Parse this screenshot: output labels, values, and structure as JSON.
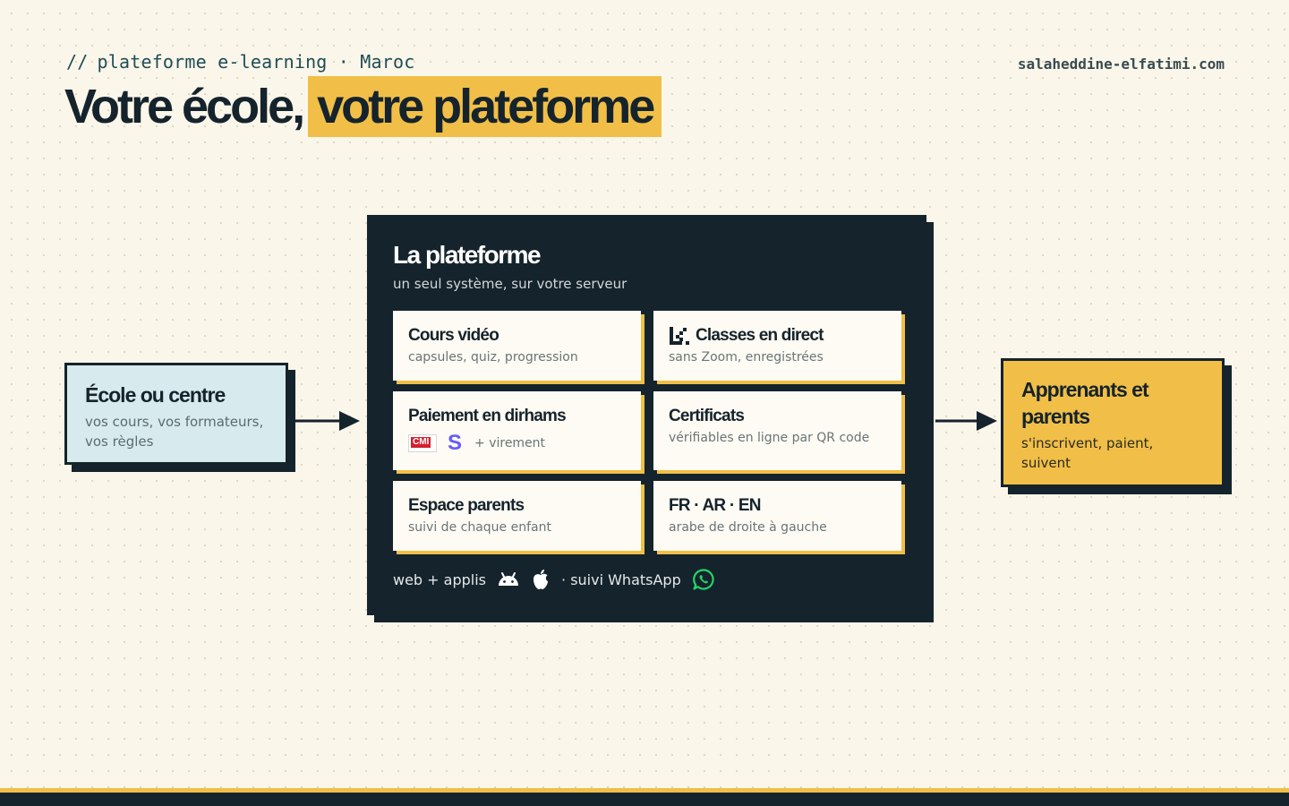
{
  "header": {
    "kicker_prefix": "//",
    "kicker": "plateforme e-learning · Maroc",
    "site": "salaheddine-elfatimi.com",
    "title_part1": "Votre école,",
    "title_highlight": "votre plateforme"
  },
  "left_box": {
    "title": "École ou centre",
    "subtitle": "vos cours, vos formateurs, vos règles"
  },
  "right_box": {
    "title": "Apprenants et parents",
    "subtitle": "s'inscrivent, paient, suivent"
  },
  "platform": {
    "title": "La plateforme",
    "subtitle": "un seul système, sur votre serveur",
    "cards": [
      {
        "title": "Cours vidéo",
        "subtitle": "capsules, quiz, progression"
      },
      {
        "title": "Classes en direct",
        "subtitle": "sans Zoom, enregistrées",
        "icon": "livekit-icon"
      },
      {
        "title": "Paiement en dirhams",
        "subtitle": "+ virement",
        "icons": [
          "cmi-logo",
          "stripe-icon"
        ],
        "cmi_text": "CMI",
        "stripe_text": "S"
      },
      {
        "title": "Certificats",
        "subtitle": "vérifiables en ligne par QR code"
      },
      {
        "title": "Espace parents",
        "subtitle": "suivi de chaque enfant"
      },
      {
        "title": "FR · AR · EN",
        "subtitle": "arabe de droite à gauche"
      }
    ],
    "footer_prefix": "web + applis",
    "footer_suffix": "· suivi WhatsApp",
    "footer_icons": [
      "android-icon",
      "apple-icon",
      "whatsapp-icon"
    ]
  },
  "colors": {
    "background": "#faf6e9",
    "navy": "#15232c",
    "accent_yellow": "#f1bf47",
    "light_blue": "#d7eaed",
    "whatsapp_green": "#25d366",
    "stripe_purple": "#635bff",
    "cmi_red": "#d3202f"
  }
}
